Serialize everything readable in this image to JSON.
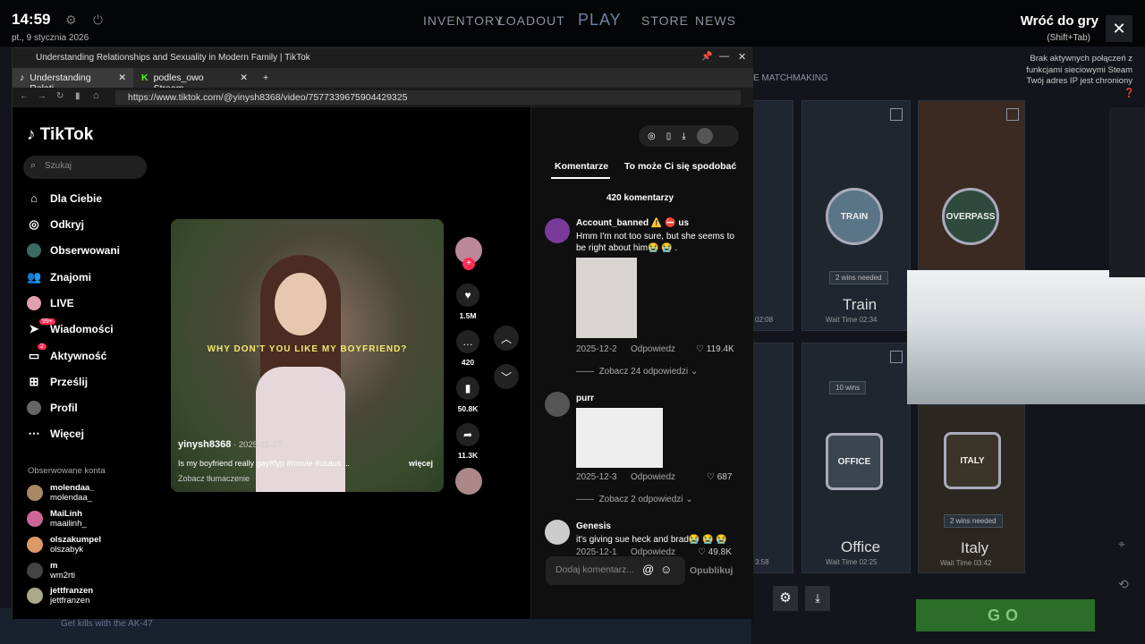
{
  "steam": {
    "clock": "14:59",
    "date": "pt., 9 stycznia 2026",
    "nav": [
      "INVENTORY",
      "LOADOUT",
      "PLAY",
      "STORE",
      "NEWS"
    ],
    "return_title": "Wróć do gry",
    "return_shortcut": "(Shift+Tab)",
    "note": "Brak aktywnych połączeń z funkcjami sieciowymi Steam Twój adres IP jest chroniony",
    "matchmaking": "E MATCHMAKING",
    "maps": [
      {
        "name": "Train",
        "wait": "Wait Time 02:34",
        "badge": "TRAIN",
        "wins": "2 wins needed"
      },
      {
        "name": "Overpass",
        "badge": "OVERPASS"
      },
      {
        "name": "Office",
        "wait": "Wait Time 02:25",
        "badge": "OFFICE",
        "wins": "10 wins"
      },
      {
        "name": "Italy",
        "wait": "Wait Time 03:42",
        "badge": "ITALY",
        "wins": "2 wins needed"
      }
    ],
    "left_time_a": "02:08",
    "left_time_b": "3:58",
    "go_label": "GO",
    "hint": "Get kills with the AK-47"
  },
  "browser": {
    "window_title": "Understanding Relationships and Sexuality in Modern Family | TikTok",
    "tabs": [
      {
        "label": "Understanding Relati...",
        "active": true
      },
      {
        "label": "podles_owo Stream ...",
        "active": false
      }
    ],
    "url": "https://www.tiktok.com/@yinysh8368/video/7577339675904429325"
  },
  "tiktok": {
    "logo": "TikTok",
    "search_placeholder": "Szukaj",
    "nav": [
      {
        "label": "Dla Ciebie",
        "icon": "home-icon"
      },
      {
        "label": "Odkryj",
        "icon": "compass-icon"
      },
      {
        "label": "Obserwowani",
        "icon": "following-icon"
      },
      {
        "label": "Znajomi",
        "icon": "friends-icon"
      },
      {
        "label": "LIVE",
        "icon": "live-icon"
      },
      {
        "label": "Wiadomości",
        "icon": "messages-icon",
        "badge": "99+"
      },
      {
        "label": "Aktywność",
        "icon": "activity-icon",
        "badge": "2"
      },
      {
        "label": "Prześlij",
        "icon": "upload-icon"
      },
      {
        "label": "Profil",
        "icon": "profile-icon"
      },
      {
        "label": "Więcej",
        "icon": "more-icon"
      }
    ],
    "following_header": "Obserwowane konta",
    "following": [
      {
        "name": "molendaa_",
        "handle": "molendaa_"
      },
      {
        "name": "MaiLinh",
        "handle": "maailinh_"
      },
      {
        "name": "olszakumpel",
        "handle": "olszabyk"
      },
      {
        "name": "m",
        "handle": "wm2rti"
      },
      {
        "name": "jettfranzen",
        "handle": "jettfranzen"
      }
    ],
    "video": {
      "caption": "WHY DON'T YOU LIKE MY BOYFRIEND?",
      "author": "yinysh8368",
      "date": " · 2025-11-27",
      "description": "Is my boyfriend really gay#fyp #movie #usaus ...",
      "more": "więcej",
      "translate": "Zobacz tłumaczenie"
    },
    "actions": {
      "likes": "1.5M",
      "comments": "420",
      "saves": "50.8K",
      "shares": "11.3K"
    },
    "comments_panel": {
      "tab_comments": "Komentarze",
      "tab_related": "To może Ci się spodobać",
      "count": "420 komentarzy",
      "items": [
        {
          "user": "Account_banned ⚠️ ⛔ us",
          "text": "Hmm I'm not too sure, but she seems to be right about him😭 😭 .",
          "date": "2025-12-2",
          "reply": "Odpowiedz",
          "likes": "119.4K",
          "more_replies": "Zobacz 24 odpowiedzi"
        },
        {
          "user": "purr",
          "text": "",
          "date": "2025-12-3",
          "reply": "Odpowiedz",
          "likes": "687",
          "more_replies": "Zobacz 2 odpowiedzi"
        },
        {
          "user": "Genesis",
          "text": "it's giving sue heck and brad😭 😭 😭",
          "date": "2025-12-1",
          "reply": "Odpowiedz",
          "likes": "49.8K"
        }
      ],
      "add_placeholder": "Dodaj komentarz...",
      "publish": "Opublikuj"
    }
  }
}
